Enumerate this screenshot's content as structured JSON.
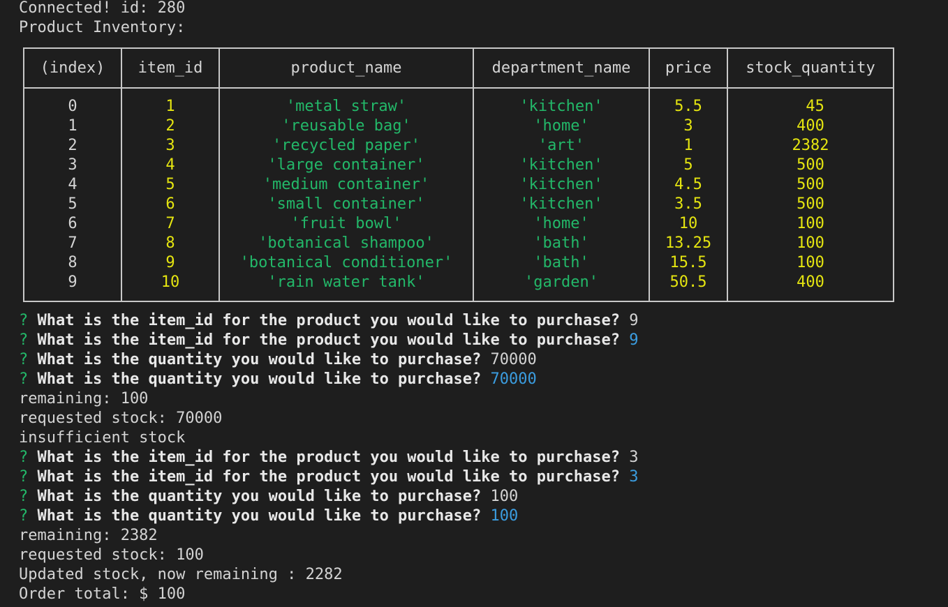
{
  "header_lines": [
    "Connected! id: 280",
    "Product Inventory:"
  ],
  "table": {
    "columns": [
      "(index)",
      "item_id",
      "product_name",
      "department_name",
      "price",
      "stock_quantity"
    ],
    "rows": [
      [
        "0",
        "1",
        "'metal straw'",
        "'kitchen'",
        "5.5",
        " 45"
      ],
      [
        "1",
        "2",
        "'reusable bag'",
        "'home'",
        "3",
        "400"
      ],
      [
        "2",
        "3",
        "'recycled paper'",
        "'art'",
        "1",
        "2382"
      ],
      [
        "3",
        "4",
        "'large container'",
        "'kitchen'",
        "5",
        "500"
      ],
      [
        "4",
        "5",
        "'medium container'",
        "'kitchen'",
        "4.5",
        "500"
      ],
      [
        "5",
        "6",
        "'small container'",
        "'kitchen'",
        "3.5",
        "500"
      ],
      [
        "6",
        "7",
        "'fruit bowl'",
        "'home'",
        "10",
        "100"
      ],
      [
        "7",
        "8",
        "'botanical shampoo'",
        "'bath'",
        "13.25",
        "100"
      ],
      [
        "8",
        "9",
        "'botanical conditioner'",
        "'bath'",
        "15.5",
        "100"
      ],
      [
        "9",
        "10",
        "'rain water tank'",
        "'garden'",
        "50.5",
        "400"
      ]
    ]
  },
  "session": [
    {
      "type": "prompt",
      "mark": "?",
      "question": "What is the item_id for the product you would like to purchase?",
      "answer": "9",
      "confirmed": false
    },
    {
      "type": "prompt",
      "mark": "?",
      "question": "What is the item_id for the product you would like to purchase?",
      "answer": "9",
      "confirmed": true
    },
    {
      "type": "prompt",
      "mark": "?",
      "question": "What is the quantity you would like to purchase?",
      "answer": "70000",
      "confirmed": false
    },
    {
      "type": "prompt",
      "mark": "?",
      "question": "What is the quantity you would like to purchase?",
      "answer": "70000",
      "confirmed": true
    },
    {
      "type": "output",
      "text": "remaining: 100"
    },
    {
      "type": "output",
      "text": "requested stock: 70000"
    },
    {
      "type": "output",
      "text": "insufficient stock"
    },
    {
      "type": "prompt",
      "mark": "?",
      "question": "What is the item_id for the product you would like to purchase?",
      "answer": "3",
      "confirmed": false
    },
    {
      "type": "prompt",
      "mark": "?",
      "question": "What is the item_id for the product you would like to purchase?",
      "answer": "3",
      "confirmed": true
    },
    {
      "type": "prompt",
      "mark": "?",
      "question": "What is the quantity you would like to purchase?",
      "answer": "100",
      "confirmed": false
    },
    {
      "type": "prompt",
      "mark": "?",
      "question": "What is the quantity you would like to purchase?",
      "answer": "100",
      "confirmed": true
    },
    {
      "type": "output",
      "text": "remaining: 2382"
    },
    {
      "type": "output",
      "text": "requested stock: 100"
    },
    {
      "type": "output",
      "text": "Updated stock, now remaining : 2282"
    },
    {
      "type": "output",
      "text": "Order total: $ 100"
    }
  ],
  "colors": {
    "background": "#1e1e1e",
    "text": "#d4d4d4",
    "string_green": "#23b869",
    "number_yellow": "#e5e510",
    "answer_blue": "#3b9de0"
  }
}
